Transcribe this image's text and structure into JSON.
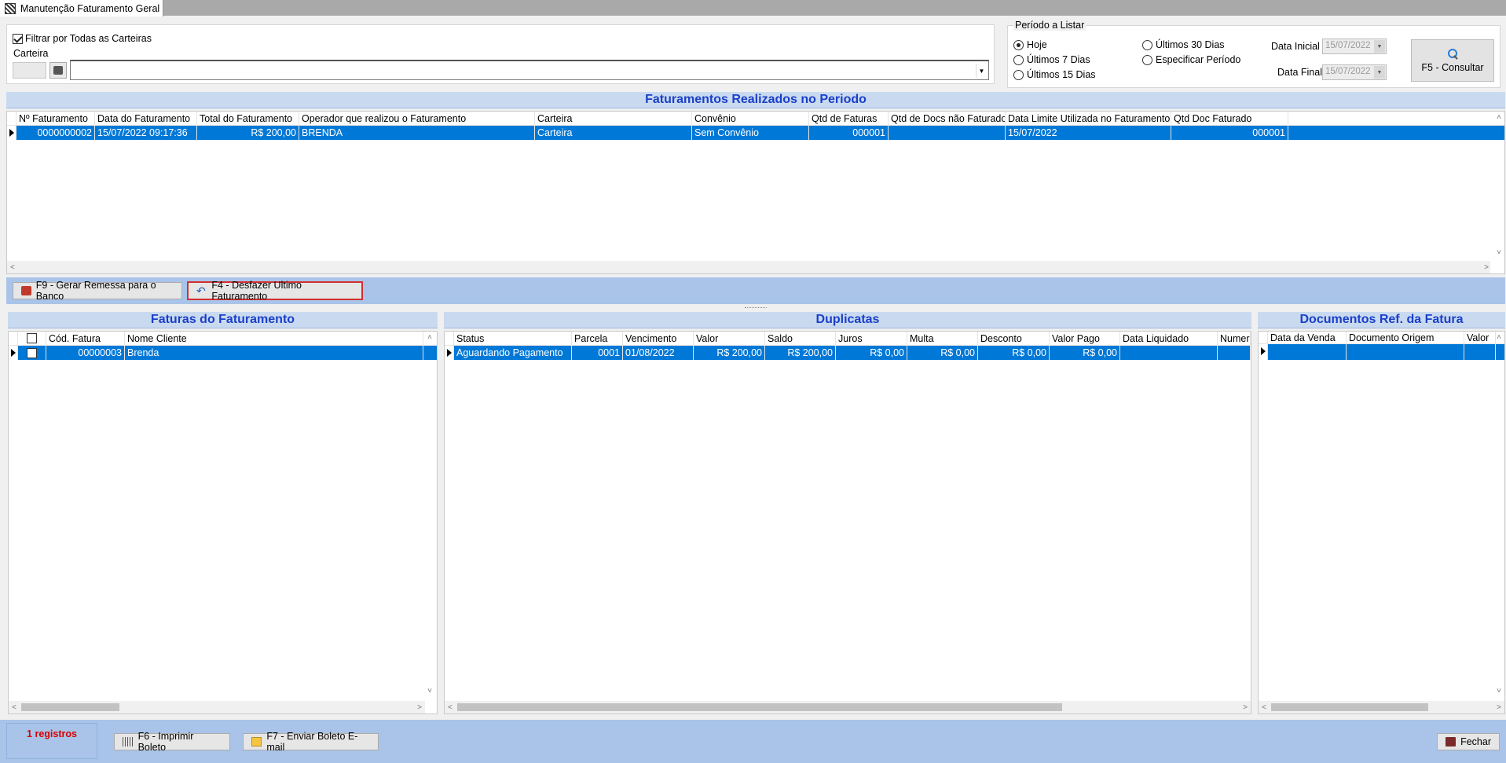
{
  "window": {
    "tab_title": "Manutenção Faturamento Geral"
  },
  "filter": {
    "all_carteiras_label": "Filtrar por Todas as Carteiras",
    "all_carteiras_checked": true,
    "carteira_label": "Carteira",
    "carteira_code": "",
    "carteira_value": ""
  },
  "periodo": {
    "group_label": "Período a Listar",
    "options": [
      "Hoje",
      "Últimos 7 Dias",
      "Últimos 15 Dias",
      "Últimos 30 Dias",
      "Especificar Período"
    ],
    "selected": "Hoje",
    "data_inicial_label": "Data Inicial",
    "data_inicial": "15/07/2022",
    "data_final_label": "Data Final",
    "data_final": "15/07/2022",
    "consultar_label": "F5 - Consultar"
  },
  "faturamentos": {
    "title": "Faturamentos Realizados no Periodo",
    "columns": [
      "Nº Faturamento",
      "Data do Faturamento",
      "Total do Faturamento",
      "Operador que realizou o Faturamento",
      "Carteira",
      "Convênio",
      "Qtd de Faturas",
      "Qtd de Docs não Faturados",
      "Data Limite Utilizada no Faturamento",
      "Qtd Doc Faturado"
    ],
    "rows": [
      [
        "0000000002",
        "15/07/2022 09:17:36",
        "R$ 200,00",
        "BRENDA",
        "Carteira",
        "Sem Convênio",
        "000001",
        "",
        "15/07/2022",
        "000001"
      ]
    ]
  },
  "actions": {
    "gerar_remessa": "F9 - Gerar Remessa para o Banco",
    "desfazer": "F4 - Desfazer Ultimo Faturamento"
  },
  "faturas": {
    "title": "Faturas do Faturamento",
    "columns": [
      "",
      "Cód. Fatura",
      "Nome Cliente"
    ],
    "rows": [
      [
        "",
        "00000003",
        "Brenda"
      ]
    ]
  },
  "duplicatas": {
    "title": "Duplicatas",
    "columns": [
      "Status",
      "Parcela",
      "Vencimento",
      "Valor",
      "Saldo",
      "Juros",
      "Multa",
      "Desconto",
      "Valor Pago",
      "Data Liquidado",
      "Numero"
    ],
    "rows": [
      [
        "Aguardando Pagamento",
        "0001",
        "01/08/2022",
        "R$ 200,00",
        "R$ 200,00",
        "R$ 0,00",
        "R$ 0,00",
        "R$ 0,00",
        "R$ 0,00",
        "",
        ""
      ]
    ]
  },
  "documentos": {
    "title": "Documentos Ref. da Fatura",
    "columns": [
      "Data da Venda",
      "Documento Origem",
      "Valor"
    ],
    "rows": [
      [
        "",
        "",
        ""
      ]
    ]
  },
  "footer": {
    "registros": "1 registros",
    "imprimir": "F6 - Imprimir Boleto",
    "enviar": "F7 - Enviar Boleto E-mail",
    "fechar": "Fechar"
  }
}
